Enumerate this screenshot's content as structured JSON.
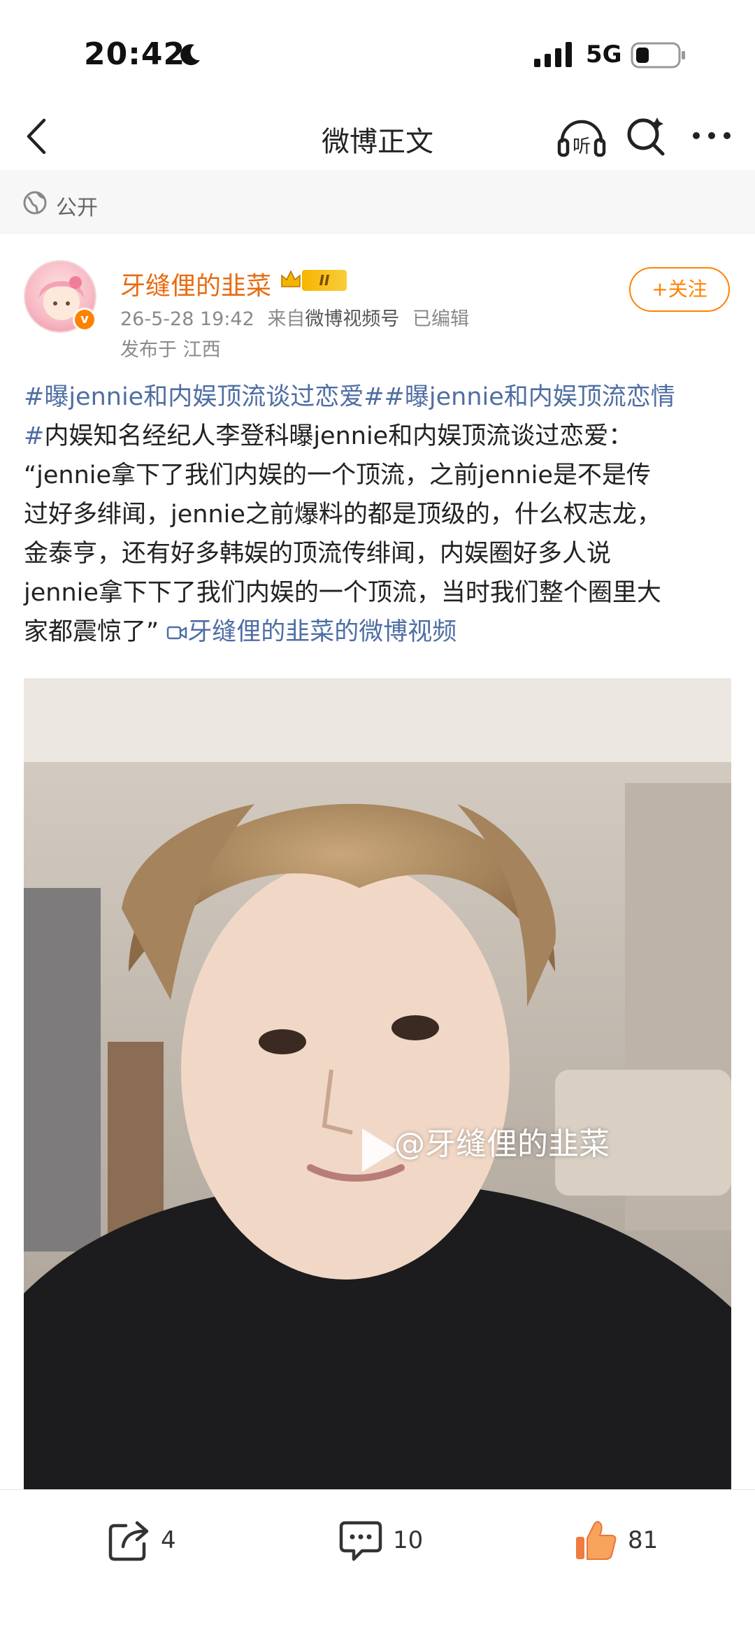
{
  "status_bar": {
    "time": "20:42",
    "network": "5G"
  },
  "nav": {
    "title": "微博正文",
    "icons": [
      "back-icon",
      "listen-icon",
      "search-icon",
      "more-icon"
    ]
  },
  "visibility": {
    "label": "公开"
  },
  "author": {
    "name": "牙缝俚的韭菜",
    "level": "II",
    "timestamp": "26-5-28 19:42",
    "from_label": "来自",
    "source": "微博视频号",
    "edited": "已编辑",
    "location": "发布于 江西",
    "follow_label": "+关注"
  },
  "post": {
    "lines": [
      {
        "tag1": "#曝jennie和内娱顶流谈过恋爱#",
        "tag2": "#曝jennie和内娱顶流恋情"
      },
      {
        "tag_end": "#",
        "text": "内娱知名经纪人李登科曝jennie和内娱顶流谈过恋爱："
      },
      {
        "text": "“jennie拿下了我们内娱的一个顶流，之前jennie是不是传"
      },
      {
        "text": "过好多绯闻，jennie之前爆料的都是顶级的，什么权志龙，"
      },
      {
        "text": "金泰亨，还有好多韩娱的顶流传绯闻，内娱圈好多人说"
      },
      {
        "text": "jennie拿下下了我们内娱的一个顶流，当时我们整个圈里大"
      },
      {
        "text": "家都震惊了”",
        "video_link": "牙缝俚的韭菜的微博视频"
      }
    ]
  },
  "video": {
    "watermark": "@牙缝俚的韭菜"
  },
  "toolbar": {
    "share_count": "4",
    "comment_count": "10",
    "like_count": "81"
  },
  "colors": {
    "accent": "#ff8200",
    "link": "#4f6ea3",
    "name": "#e86b12"
  }
}
